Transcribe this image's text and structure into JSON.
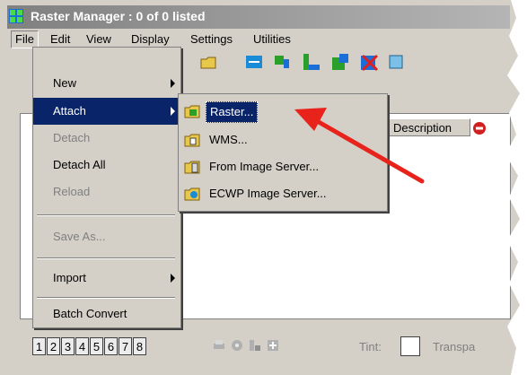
{
  "window": {
    "title": "Raster Manager : 0 of 0 listed"
  },
  "menubar": [
    {
      "label": "File"
    },
    {
      "label": "Edit"
    },
    {
      "label": "View"
    },
    {
      "label": "Display"
    },
    {
      "label": "Settings"
    },
    {
      "label": "Utilities"
    }
  ],
  "file_menu": [
    {
      "label": "New",
      "state": "enabled",
      "submenu": true
    },
    {
      "label": "Attach",
      "state": "highlighted",
      "submenu": true
    },
    {
      "label": "Detach",
      "state": "disabled"
    },
    {
      "label": "Detach All",
      "state": "enabled"
    },
    {
      "label": "Reload",
      "state": "disabled"
    },
    {
      "label": "Save As...",
      "state": "disabled"
    },
    {
      "label": "Import",
      "state": "enabled",
      "submenu": true
    },
    {
      "label": "Batch Convert",
      "state": "enabled"
    }
  ],
  "attach_submenu": [
    {
      "label": "Raster...",
      "state": "highlighted"
    },
    {
      "label": "WMS...",
      "state": "enabled"
    },
    {
      "label": "From Image Server...",
      "state": "enabled"
    },
    {
      "label": "ECWP Image Server...",
      "state": "enabled"
    }
  ],
  "table_header": {
    "description": "Description"
  },
  "view_buttons": [
    "1",
    "2",
    "3",
    "4",
    "5",
    "6",
    "7",
    "8"
  ],
  "bottom": {
    "tint_label": "Tint:",
    "transparency_label": "Transpa"
  },
  "colors": {
    "highlight": "#0a246a",
    "arrow": "#e8231c",
    "title_gradient_start": "#808080"
  },
  "icons": [
    "app-raster-icon",
    "attach-raster-icon",
    "wms-icon",
    "image-server-icon",
    "ecwp-icon",
    "no-icon",
    "print-icon",
    "gear-icon"
  ]
}
